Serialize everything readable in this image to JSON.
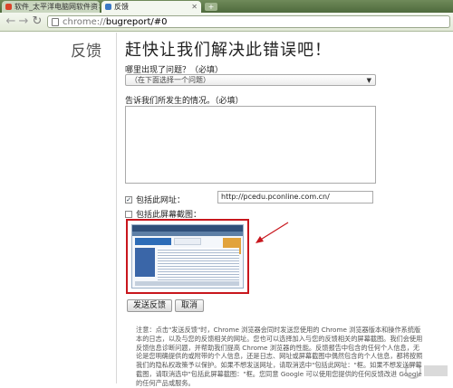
{
  "browser": {
    "tabs": [
      {
        "title": "软件_太平洋电脑网软件资",
        "favicon_color": "#d9442b"
      },
      {
        "title": "反馈",
        "favicon_color": "#3b78c4"
      }
    ],
    "url_scheme": "chrome://",
    "url_host": "bugreport/#0"
  },
  "sidebar": {
    "title": "反馈"
  },
  "main": {
    "title": "赶快让我们解决此错误吧！",
    "problem_label": "哪里出现了问题？（必填）",
    "problem_select": "（在下面选择一个问题）",
    "describe_label": "告诉我们所发生的情况。（必填）",
    "describe_value": "",
    "include_url_label": "包括此网址：",
    "include_url_checked": true,
    "url_value": "http://pcedu.pconline.com.cn/",
    "include_screenshot_label": "包括此屏幕截图：",
    "include_screenshot_checked": false,
    "send_button": "发送反馈",
    "cancel_button": "取消",
    "note": "注意：点击\"发送反馈\"时，Chrome 浏览器会同时发送您使用的 Chrome 浏览器版本和操作系统版本的日志，以及与您的反馈相关的网址。您也可以选择加入与您的反馈相关的屏幕截图。我们会使用反馈信息诊断问题，并帮助我们提高 Chrome 浏览器的性能。反馈报告中包含的任何个人信息，无论是您明确提供的或附带的个人信息，还是日志、网址或屏幕截图中偶然包含的个人信息，都将按照我们的隐私权政策予以保护。如果不想发送网址，请取消选中\"包括此网址：\"框。如果不想发送屏幕截图，请取消选中\"包括此屏幕截图：\"框。您同意 Google 可以使用您提供的任何反馈改进 Google 的任何产品或服务。"
  },
  "colors": {
    "highlight_box": "#c8161d",
    "arrow": "#c8161d"
  }
}
